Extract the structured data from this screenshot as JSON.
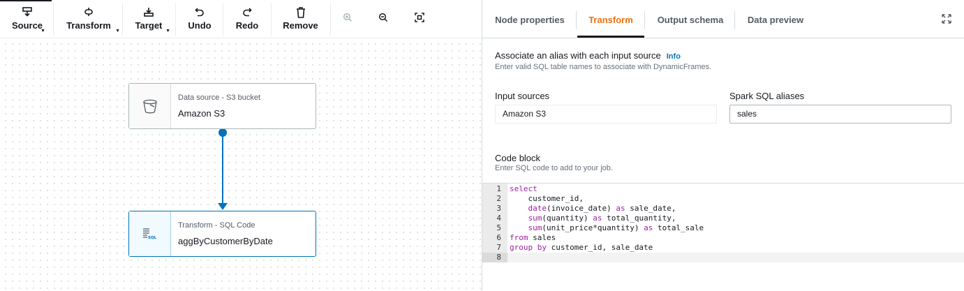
{
  "toolbar": {
    "buttons": [
      {
        "label": "Source",
        "icon": "source-icon",
        "dropdown": true
      },
      {
        "label": "Transform",
        "icon": "transform-icon",
        "dropdown": true
      },
      {
        "label": "Target",
        "icon": "target-icon",
        "dropdown": true
      },
      {
        "label": "Undo",
        "icon": "undo-icon",
        "dropdown": false
      },
      {
        "label": "Redo",
        "icon": "redo-icon",
        "dropdown": false
      },
      {
        "label": "Remove",
        "icon": "trash-icon",
        "dropdown": false
      }
    ],
    "zoom_controls": [
      "zoom-in-icon",
      "zoom-out-icon",
      "fit-screen-icon"
    ]
  },
  "nodes": [
    {
      "type": "Data source - S3 bucket",
      "name": "Amazon S3",
      "icon": "bucket-icon",
      "selected": false
    },
    {
      "type": "Transform - SQL Code",
      "name": "aggByCustomerByDate",
      "icon": "sql-icon",
      "selected": true
    }
  ],
  "panel": {
    "tabs": [
      {
        "label": "Node properties",
        "active": false
      },
      {
        "label": "Transform",
        "active": true
      },
      {
        "label": "Output schema",
        "active": false
      },
      {
        "label": "Data preview",
        "active": false
      }
    ],
    "alias_section": {
      "title": "Associate an alias with each input source",
      "info": "Info",
      "description": "Enter valid SQL table names to associate with DynamicFrames."
    },
    "input_sources_label": "Input sources",
    "input_sources_value": "Amazon S3",
    "aliases_label": "Spark SQL aliases",
    "aliases_value": "sales",
    "code_section": {
      "title": "Code block",
      "description": "Enter SQL code to add to your job."
    },
    "code_lines": [
      "select",
      "    customer_id,",
      "    date(invoice_date) as sale_date,",
      "    sum(quantity) as total_quantity,",
      "    sum(unit_price*quantity) as total_sale",
      "from sales",
      "group by customer_id, sale_date",
      ""
    ],
    "active_line": 8
  },
  "colors": {
    "accent": "#ec7211",
    "edge": "#0073bb",
    "keyword": "#a020a0"
  }
}
